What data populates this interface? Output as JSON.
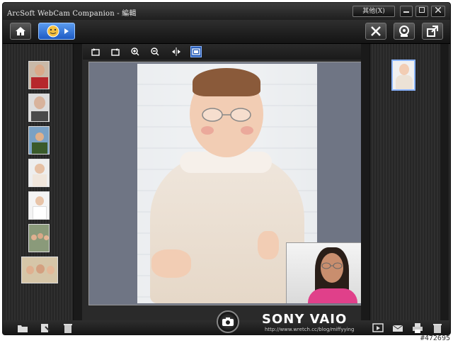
{
  "window": {
    "title": "ArcSoft WebCam Companion - 編輯",
    "other_button": "其他(X)"
  },
  "toolbar": {
    "home_icon": "home-icon",
    "edit_icon": "face-edit-icon",
    "tools_icon": "tools-icon",
    "webcam_icon": "webcam-icon",
    "export_icon": "export-icon"
  },
  "view_tools": [
    "rotate-left-icon",
    "rotate-right-icon",
    "zoom-in-icon",
    "zoom-out-icon",
    "flip-icon",
    "fit-icon"
  ],
  "thumbnails": [
    {
      "name": "woman-red-shirt"
    },
    {
      "name": "bald-man"
    },
    {
      "name": "kids-outdoors"
    },
    {
      "name": "baby-sitting"
    },
    {
      "name": "baby-white"
    },
    {
      "name": "group-photo"
    },
    {
      "name": "group-selfie"
    }
  ],
  "bottom": {
    "left_icons": [
      "open-folder-icon",
      "import-icon",
      "trash-icon"
    ],
    "right_icons": [
      "slideshow-icon",
      "email-icon",
      "print-icon",
      "trash-icon"
    ],
    "brand": "SONY VAIO",
    "brand_url": "http://www.wretch.cc/blog/miffyying"
  },
  "watermark": "#472695"
}
